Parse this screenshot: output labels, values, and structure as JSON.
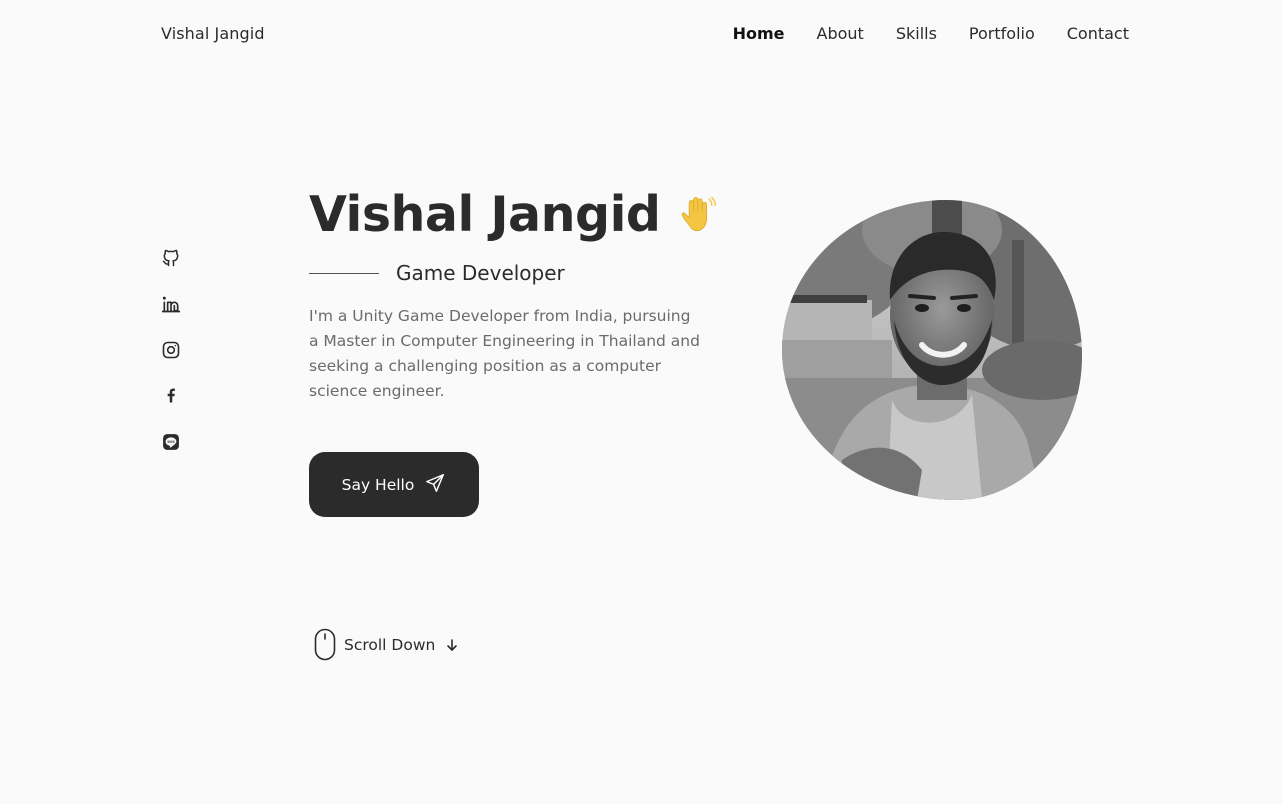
{
  "header": {
    "logo": "Vishal Jangid",
    "nav": [
      {
        "label": "Home",
        "active": true
      },
      {
        "label": "About",
        "active": false
      },
      {
        "label": "Skills",
        "active": false
      },
      {
        "label": "Portfolio",
        "active": false
      },
      {
        "label": "Contact",
        "active": false
      }
    ]
  },
  "social_icons": [
    "github-icon",
    "linkedin-icon",
    "instagram-icon",
    "facebook-icon",
    "line-icon"
  ],
  "hero": {
    "title": "Vishal Jangid",
    "title_emoji": "waving-hand-icon",
    "subtitle": "Game Developer",
    "description": "I'm a Unity Game Developer from India, pursuing a Master in Computer Engineering in Thailand and seeking a challenging position as a computer science engineer.",
    "cta_label": "Say Hello",
    "cta_icon": "send-icon"
  },
  "scroll": {
    "label": "Scroll Down",
    "icon": "mouse-icon",
    "arrow_icon": "arrow-down-icon"
  },
  "colors": {
    "background": "#fafafa",
    "text": "#2b2b2b",
    "muted": "#6b6b6b",
    "button": "#2b2b2b",
    "wave": "#f4c542"
  }
}
